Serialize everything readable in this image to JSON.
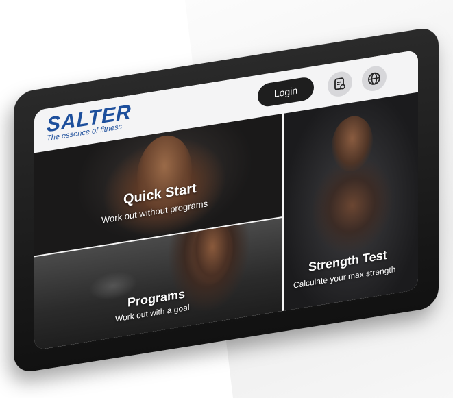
{
  "brand": {
    "name": "SALTER",
    "tagline": "The essence of fitness",
    "color": "#1d4f9c"
  },
  "header": {
    "login_label": "Login",
    "icons": [
      "document-icon",
      "globe-icon"
    ]
  },
  "tiles": [
    {
      "title": "Quick Start",
      "subtitle": "Work out without programs"
    },
    {
      "title": "Programs",
      "subtitle": "Work out with a goal"
    },
    {
      "title": "Strength Test",
      "subtitle": "Calculate your max strength"
    }
  ],
  "colors": {
    "bezel": "#151515",
    "login_button": "#1e1e1e",
    "icon_button": "#d7d7da"
  }
}
